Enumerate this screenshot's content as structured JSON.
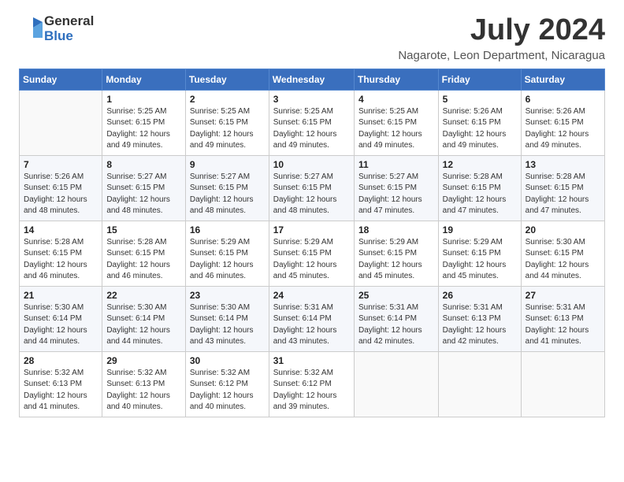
{
  "header": {
    "logo_general": "General",
    "logo_blue": "Blue",
    "month_title": "July 2024",
    "location": "Nagarote, Leon Department, Nicaragua"
  },
  "weekdays": [
    "Sunday",
    "Monday",
    "Tuesday",
    "Wednesday",
    "Thursday",
    "Friday",
    "Saturday"
  ],
  "weeks": [
    [
      {
        "day": "",
        "info": ""
      },
      {
        "day": "1",
        "info": "Sunrise: 5:25 AM\nSunset: 6:15 PM\nDaylight: 12 hours\nand 49 minutes."
      },
      {
        "day": "2",
        "info": "Sunrise: 5:25 AM\nSunset: 6:15 PM\nDaylight: 12 hours\nand 49 minutes."
      },
      {
        "day": "3",
        "info": "Sunrise: 5:25 AM\nSunset: 6:15 PM\nDaylight: 12 hours\nand 49 minutes."
      },
      {
        "day": "4",
        "info": "Sunrise: 5:25 AM\nSunset: 6:15 PM\nDaylight: 12 hours\nand 49 minutes."
      },
      {
        "day": "5",
        "info": "Sunrise: 5:26 AM\nSunset: 6:15 PM\nDaylight: 12 hours\nand 49 minutes."
      },
      {
        "day": "6",
        "info": "Sunrise: 5:26 AM\nSunset: 6:15 PM\nDaylight: 12 hours\nand 49 minutes."
      }
    ],
    [
      {
        "day": "7",
        "info": "Sunrise: 5:26 AM\nSunset: 6:15 PM\nDaylight: 12 hours\nand 48 minutes."
      },
      {
        "day": "8",
        "info": "Sunrise: 5:27 AM\nSunset: 6:15 PM\nDaylight: 12 hours\nand 48 minutes."
      },
      {
        "day": "9",
        "info": "Sunrise: 5:27 AM\nSunset: 6:15 PM\nDaylight: 12 hours\nand 48 minutes."
      },
      {
        "day": "10",
        "info": "Sunrise: 5:27 AM\nSunset: 6:15 PM\nDaylight: 12 hours\nand 48 minutes."
      },
      {
        "day": "11",
        "info": "Sunrise: 5:27 AM\nSunset: 6:15 PM\nDaylight: 12 hours\nand 47 minutes."
      },
      {
        "day": "12",
        "info": "Sunrise: 5:28 AM\nSunset: 6:15 PM\nDaylight: 12 hours\nand 47 minutes."
      },
      {
        "day": "13",
        "info": "Sunrise: 5:28 AM\nSunset: 6:15 PM\nDaylight: 12 hours\nand 47 minutes."
      }
    ],
    [
      {
        "day": "14",
        "info": "Sunrise: 5:28 AM\nSunset: 6:15 PM\nDaylight: 12 hours\nand 46 minutes."
      },
      {
        "day": "15",
        "info": "Sunrise: 5:28 AM\nSunset: 6:15 PM\nDaylight: 12 hours\nand 46 minutes."
      },
      {
        "day": "16",
        "info": "Sunrise: 5:29 AM\nSunset: 6:15 PM\nDaylight: 12 hours\nand 46 minutes."
      },
      {
        "day": "17",
        "info": "Sunrise: 5:29 AM\nSunset: 6:15 PM\nDaylight: 12 hours\nand 45 minutes."
      },
      {
        "day": "18",
        "info": "Sunrise: 5:29 AM\nSunset: 6:15 PM\nDaylight: 12 hours\nand 45 minutes."
      },
      {
        "day": "19",
        "info": "Sunrise: 5:29 AM\nSunset: 6:15 PM\nDaylight: 12 hours\nand 45 minutes."
      },
      {
        "day": "20",
        "info": "Sunrise: 5:30 AM\nSunset: 6:15 PM\nDaylight: 12 hours\nand 44 minutes."
      }
    ],
    [
      {
        "day": "21",
        "info": "Sunrise: 5:30 AM\nSunset: 6:14 PM\nDaylight: 12 hours\nand 44 minutes."
      },
      {
        "day": "22",
        "info": "Sunrise: 5:30 AM\nSunset: 6:14 PM\nDaylight: 12 hours\nand 44 minutes."
      },
      {
        "day": "23",
        "info": "Sunrise: 5:30 AM\nSunset: 6:14 PM\nDaylight: 12 hours\nand 43 minutes."
      },
      {
        "day": "24",
        "info": "Sunrise: 5:31 AM\nSunset: 6:14 PM\nDaylight: 12 hours\nand 43 minutes."
      },
      {
        "day": "25",
        "info": "Sunrise: 5:31 AM\nSunset: 6:14 PM\nDaylight: 12 hours\nand 42 minutes."
      },
      {
        "day": "26",
        "info": "Sunrise: 5:31 AM\nSunset: 6:13 PM\nDaylight: 12 hours\nand 42 minutes."
      },
      {
        "day": "27",
        "info": "Sunrise: 5:31 AM\nSunset: 6:13 PM\nDaylight: 12 hours\nand 41 minutes."
      }
    ],
    [
      {
        "day": "28",
        "info": "Sunrise: 5:32 AM\nSunset: 6:13 PM\nDaylight: 12 hours\nand 41 minutes."
      },
      {
        "day": "29",
        "info": "Sunrise: 5:32 AM\nSunset: 6:13 PM\nDaylight: 12 hours\nand 40 minutes."
      },
      {
        "day": "30",
        "info": "Sunrise: 5:32 AM\nSunset: 6:12 PM\nDaylight: 12 hours\nand 40 minutes."
      },
      {
        "day": "31",
        "info": "Sunrise: 5:32 AM\nSunset: 6:12 PM\nDaylight: 12 hours\nand 39 minutes."
      },
      {
        "day": "",
        "info": ""
      },
      {
        "day": "",
        "info": ""
      },
      {
        "day": "",
        "info": ""
      }
    ]
  ]
}
